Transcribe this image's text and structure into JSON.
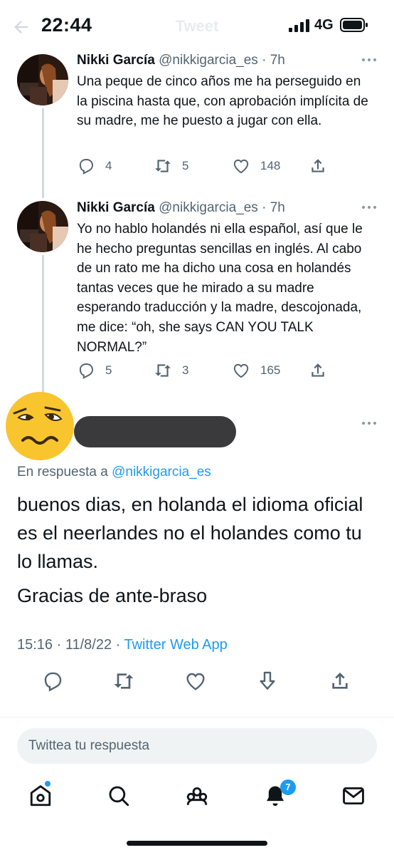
{
  "status_bar": {
    "time": "22:44",
    "network": "4G",
    "header_title": "Tweet"
  },
  "tweets": [
    {
      "name": "Nikki García",
      "handle": "@nikkigarcia_es",
      "time": "· 7h",
      "text": "Una peque de cinco años me ha perseguido en la piscina hasta que, con aprobación implícita de su madre, me he puesto a jugar con ella.",
      "replies": "4",
      "retweets": "5",
      "likes": "148"
    },
    {
      "name": "Nikki García",
      "handle": "@nikkigarcia_es",
      "time": "· 7h",
      "text": "Yo no hablo holandés ni ella español, así que le he hecho preguntas sencillas en inglés. Al cabo de un rato me ha dicho una cosa en holandés tantas veces que he mirado a su madre esperando traducción y la madre, descojonada, me dice: “oh, she says CAN YOU TALK NORMAL?”",
      "replies": "5",
      "retweets": "3",
      "likes": "165"
    }
  ],
  "main_tweet": {
    "reply_prefix": "En respuesta a",
    "reply_handle": "@nikkigarcia_es",
    "paragraph1": "buenos dias, en holanda el idioma oficial es el neerlandes no el holandes como tu lo llamas.",
    "paragraph2": "Gracias de ante-braso",
    "timestamp": "15:16 · 11/8/22 ·",
    "source_app": "Twitter Web App"
  },
  "reply_box": {
    "placeholder": "Twittea tu respuesta"
  },
  "nav": {
    "notifications_count": "7",
    "items": [
      "home-icon",
      "search-icon",
      "communities-icon",
      "notifications-icon",
      "messages-icon"
    ]
  },
  "colors": {
    "accent": "#1d9bf0",
    "text": "#0f1419",
    "secondary": "#536471",
    "thread_line": "#cfd9de"
  }
}
